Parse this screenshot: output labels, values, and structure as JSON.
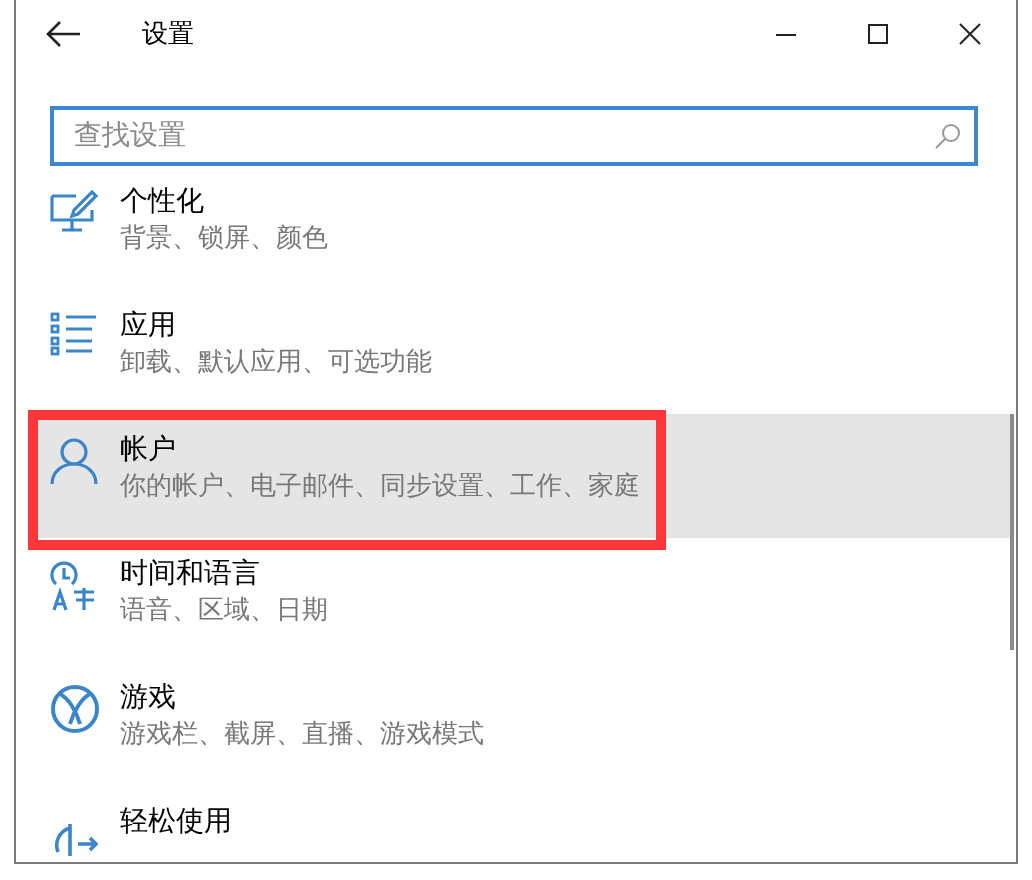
{
  "window": {
    "title": "设置"
  },
  "search": {
    "placeholder": "查找设置"
  },
  "items": [
    {
      "title": "个性化",
      "subtitle": "背景、锁屏、颜色",
      "selected": false,
      "annotated": false
    },
    {
      "title": "应用",
      "subtitle": "卸载、默认应用、可选功能",
      "selected": false,
      "annotated": false
    },
    {
      "title": "帐户",
      "subtitle": "你的帐户、电子邮件、同步设置、工作、家庭",
      "selected": true,
      "annotated": true
    },
    {
      "title": "时间和语言",
      "subtitle": "语音、区域、日期",
      "selected": false,
      "annotated": false
    },
    {
      "title": "游戏",
      "subtitle": "游戏栏、截屏、直播、游戏模式",
      "selected": false,
      "annotated": false
    },
    {
      "title": "轻松使用",
      "selected": false,
      "annotated": false
    }
  ]
}
